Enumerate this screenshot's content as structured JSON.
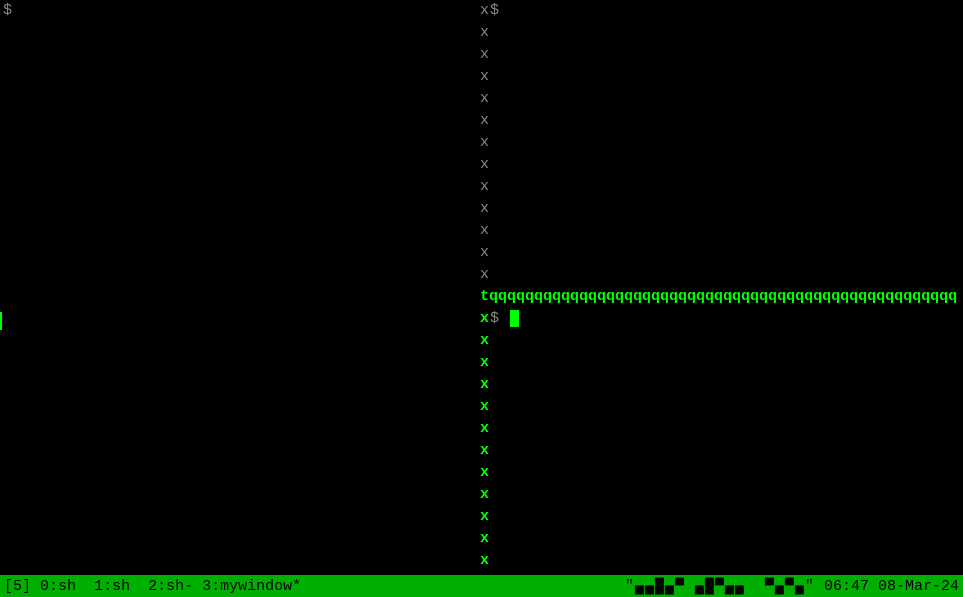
{
  "left_pane": {
    "prompt": "$"
  },
  "right_top_pane": {
    "prompt": "$"
  },
  "right_bottom_pane": {
    "prompt": "$"
  },
  "borders": {
    "vertical_char": "x",
    "horizontal_char": "q",
    "tee_char": "t"
  },
  "status": {
    "session": "[5]",
    "windows": [
      {
        "index": "0",
        "name": "sh",
        "flags": ""
      },
      {
        "index": "1",
        "name": "sh",
        "flags": ""
      },
      {
        "index": "2",
        "name": "sh",
        "flags": "-"
      },
      {
        "index": "3",
        "name": "mywindow",
        "flags": "*"
      }
    ],
    "hostname": "\"▄▄█▄▀ ▄█▀▄▄  ▀▄▀▄\"",
    "time": "06:47",
    "date": "08-Mar-24"
  }
}
